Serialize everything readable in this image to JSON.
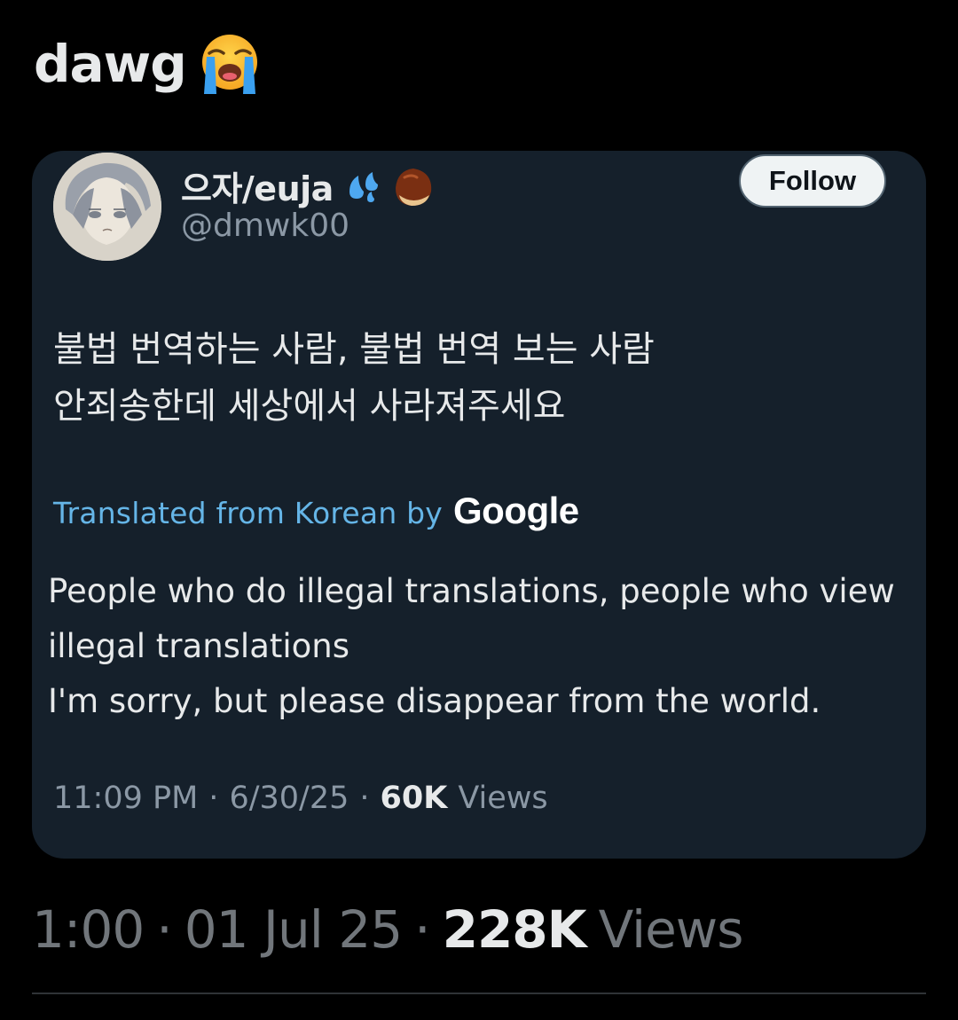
{
  "post": {
    "text": "dawg",
    "emoji": "loudly-crying-face-icon",
    "time": "1:00",
    "sep1": "·",
    "date": "01 Jul 25",
    "sep2": "·",
    "views_count": "228K",
    "views_label": "Views"
  },
  "quoted_post": {
    "display_name": "으자/euja",
    "name_emojis": [
      "sweat-droplets-icon",
      "chestnut-icon"
    ],
    "handle": "@dmwk00",
    "follow_label": "Follow",
    "korean_text": "불법 번역하는 사람, 불법 번역 보는 사람\n안죄송한데 세상에서 사라져주세요",
    "translated_from": "Translated from Korean by",
    "translator_brand": "Google",
    "translation": "People who do illegal translations, people who view illegal translations\nI'm sorry, but please disappear from the world.",
    "time": "11:09 PM",
    "sep1": "·",
    "date": "6/30/25",
    "sep2": "·",
    "views_count": "60K",
    "views_label": "Views"
  },
  "colors": {
    "background": "#000000",
    "card": "#15202b",
    "link_blue": "#65b5e7",
    "muted": "#8b98a5"
  }
}
